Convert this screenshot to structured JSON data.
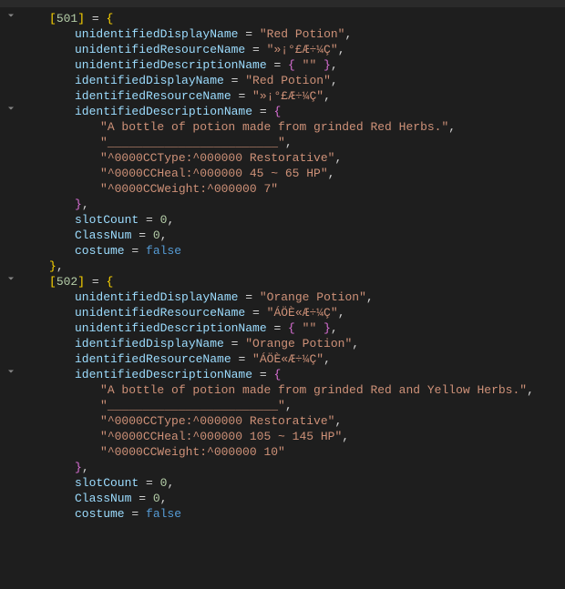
{
  "items": [
    {
      "id": "501",
      "unidentifiedDisplayName": "Red Potion",
      "unidentifiedResourceName": "»¡°£Æ÷¼Ç",
      "unidentifiedDescriptionName": [
        "\"\""
      ],
      "identifiedDisplayName": "Red Potion",
      "identifiedResourceName": "»¡°£Æ÷¼Ç",
      "identifiedDescriptionName": [
        "A bottle of potion made from grinded Red Herbs.",
        "________________________",
        "^0000CCType:^000000 Restorative",
        "^0000CCHeal:^000000 45 ~ 65 HP",
        "^0000CCWeight:^000000 7"
      ],
      "slotCount": "0",
      "ClassNum": "0",
      "costume": "false"
    },
    {
      "id": "502",
      "unidentifiedDisplayName": "Orange Potion",
      "unidentifiedResourceName": "ÁÖÈ«Æ÷¼Ç",
      "unidentifiedDescriptionName": [
        "\"\""
      ],
      "identifiedDisplayName": "Orange Potion",
      "identifiedResourceName": "ÁÖÈ«Æ÷¼Ç",
      "identifiedDescriptionName": [
        "A bottle of potion made from grinded Red and Yellow Herbs.",
        "________________________",
        "^0000CCType:^000000 Restorative",
        "^0000CCHeal:^000000 105 ~ 145 HP",
        "^0000CCWeight:^000000 10"
      ],
      "slotCount": "0",
      "ClassNum": "0",
      "costume": "false"
    }
  ],
  "labels": {
    "unidentifiedDisplayName": "unidentifiedDisplayName",
    "unidentifiedResourceName": "unidentifiedResourceName",
    "unidentifiedDescriptionName": "unidentifiedDescriptionName",
    "identifiedDisplayName": "identifiedDisplayName",
    "identifiedResourceName": "identifiedResourceName",
    "identifiedDescriptionName": "identifiedDescriptionName",
    "slotCount": "slotCount",
    "ClassNum": "ClassNum",
    "costume": "costume"
  }
}
